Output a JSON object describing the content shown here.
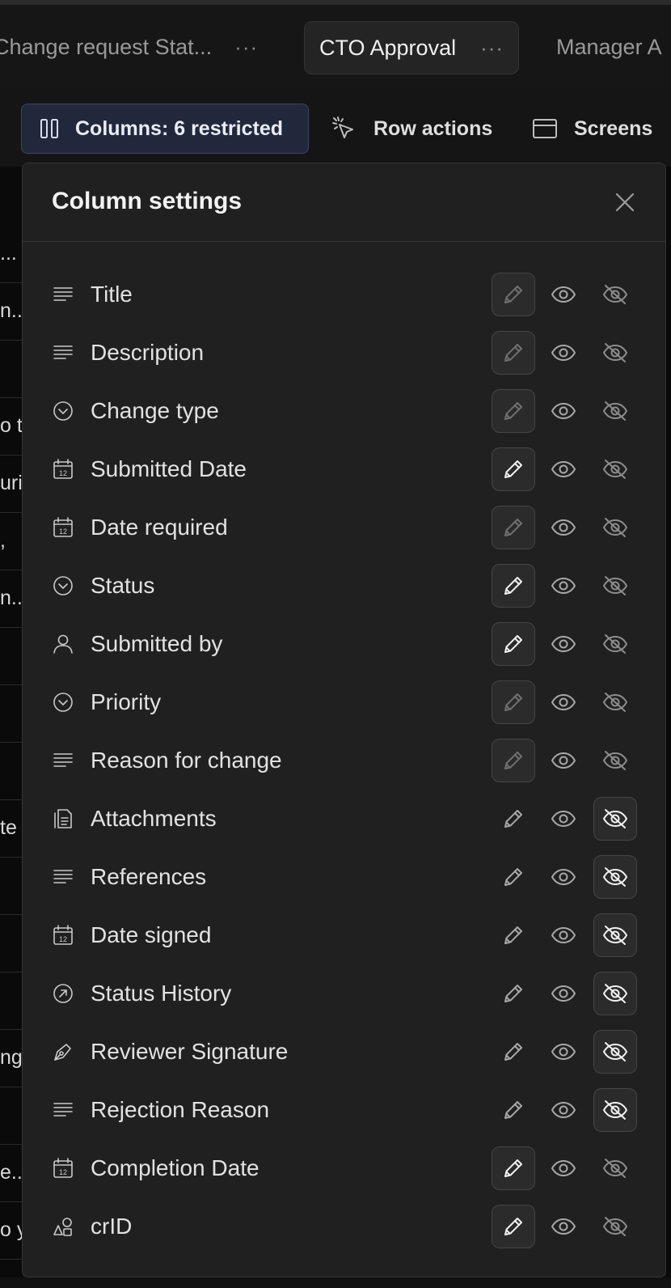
{
  "tabs": [
    {
      "label": "Change request Stat...",
      "active": false,
      "more": "···"
    },
    {
      "label": "CTO Approval",
      "active": true,
      "more": "···"
    },
    {
      "label": "Manager A",
      "active": false,
      "more": ""
    }
  ],
  "toolbar": {
    "columns_label": "Columns: 6 restricted",
    "row_actions_label": "Row actions",
    "screens_label": "Screens"
  },
  "background_rows": [
    "...",
    "n..",
    "",
    "o th",
    "uri",
    ",",
    "n..",
    "",
    "",
    "",
    "te",
    "",
    "",
    "",
    "ng",
    "",
    "e..",
    "o y"
  ],
  "panel": {
    "title": "Column settings",
    "columns": [
      {
        "label": "Title",
        "icon": "text-lines-icon",
        "mode": "edit-disabled"
      },
      {
        "label": "Description",
        "icon": "text-lines-icon",
        "mode": "edit-disabled"
      },
      {
        "label": "Change type",
        "icon": "dropdown-circle-icon",
        "mode": "edit-disabled"
      },
      {
        "label": "Submitted Date",
        "icon": "calendar-icon",
        "mode": "edit"
      },
      {
        "label": "Date required",
        "icon": "calendar-icon",
        "mode": "edit-disabled"
      },
      {
        "label": "Status",
        "icon": "dropdown-circle-icon",
        "mode": "edit"
      },
      {
        "label": "Submitted by",
        "icon": "person-icon",
        "mode": "edit"
      },
      {
        "label": "Priority",
        "icon": "dropdown-circle-icon",
        "mode": "edit-disabled"
      },
      {
        "label": "Reason for change",
        "icon": "text-lines-icon",
        "mode": "edit-disabled"
      },
      {
        "label": "Attachments",
        "icon": "document-icon",
        "mode": "hidden"
      },
      {
        "label": "References",
        "icon": "text-lines-icon",
        "mode": "hidden"
      },
      {
        "label": "Date signed",
        "icon": "calendar-icon",
        "mode": "hidden"
      },
      {
        "label": "Status History",
        "icon": "arrow-circle-icon",
        "mode": "hidden"
      },
      {
        "label": "Reviewer Signature",
        "icon": "pen-nib-icon",
        "mode": "hidden"
      },
      {
        "label": "Rejection Reason",
        "icon": "text-lines-icon",
        "mode": "hidden"
      },
      {
        "label": "Completion Date",
        "icon": "calendar-icon",
        "mode": "edit"
      },
      {
        "label": "crID",
        "icon": "shapes-icon",
        "mode": "edit"
      }
    ]
  },
  "colors": {
    "panel_bg": "#202020",
    "columns_button_bg": "#22283c",
    "page_bg": "#111111"
  }
}
